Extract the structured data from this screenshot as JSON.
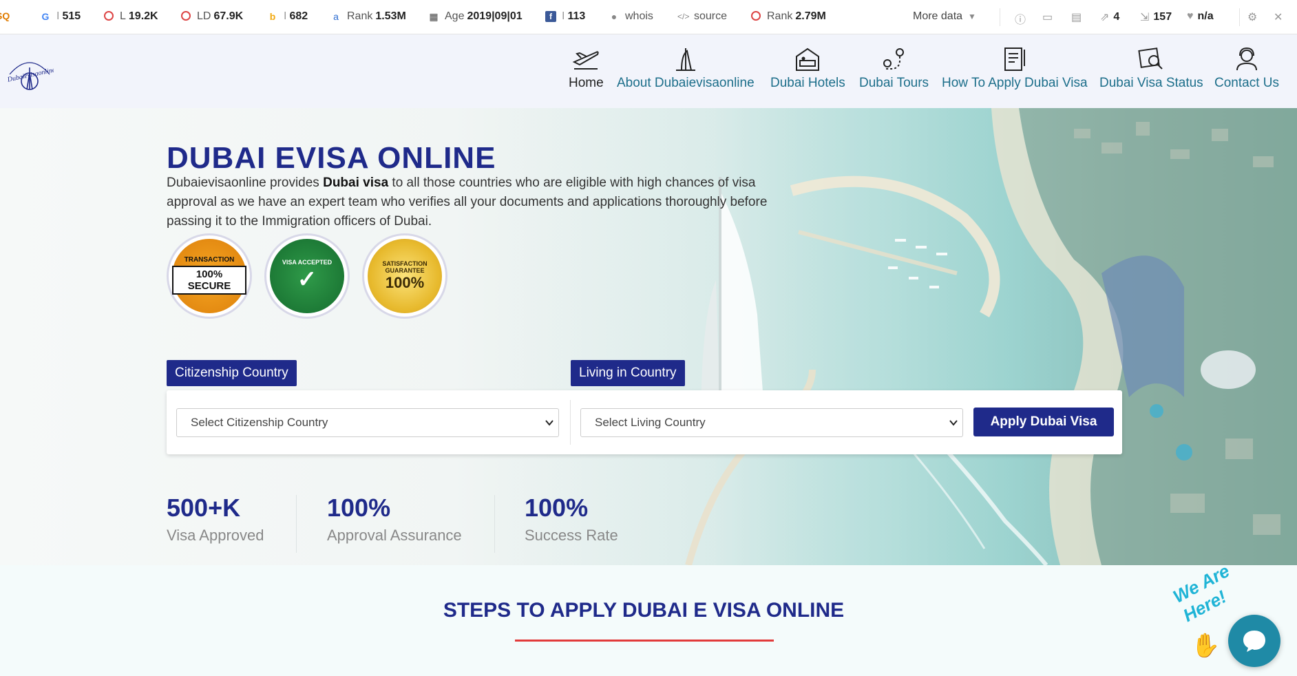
{
  "seo_bar": {
    "google": "515",
    "links": "19.2K",
    "link_domains": "67.9K",
    "bing": "682",
    "rank1": "1.53M",
    "age": "2019|09|01",
    "facebook": "113",
    "whois": "whois",
    "source": "source",
    "rank2": "2.79M",
    "more_data": "More data",
    "external_links": "4",
    "internal_links": "157",
    "na": "n/a"
  },
  "header": {
    "logo_text": "Dubaievisaonline",
    "nav": [
      {
        "label": "Home"
      },
      {
        "label": "About Dubaievisaonline"
      },
      {
        "label": "Dubai Hotels"
      },
      {
        "label": "Dubai Tours"
      },
      {
        "label": "How To Apply Dubai Visa"
      },
      {
        "label": "Dubai Visa Status"
      },
      {
        "label": "Contact Us"
      }
    ]
  },
  "hero": {
    "title": "DUBAI EVISA ONLINE",
    "desc_start": "Dubaievisaonline provides ",
    "desc_bold": "Dubai visa",
    "desc_end": " to all those countries who are eligible with high chances of visa approval as we have an expert team who verifies all your documents and applications thoroughly before passing it to the Immigration officers of Dubai.",
    "badges": [
      {
        "text": "100% SECURE",
        "ring_text": "TRANSACTION"
      },
      {
        "text": "✓",
        "ring_text": "VISA ACCEPTED"
      },
      {
        "text": "100%",
        "ring_text": "SATISFACTION GUARANTEE"
      }
    ]
  },
  "form": {
    "citizenship_label": "Citizenship Country",
    "living_label": "Living in Country",
    "citizenship_placeholder": "Select Citizenship Country",
    "living_placeholder": "Select Living Country",
    "apply_button": "Apply Dubai Visa"
  },
  "stats": [
    {
      "value": "500+K",
      "label": "Visa Approved"
    },
    {
      "value": "100%",
      "label": "Approval Assurance"
    },
    {
      "value": "100%",
      "label": "Success Rate"
    }
  ],
  "steps": {
    "title": "STEPS TO APPLY DUBAI E VISA ONLINE"
  },
  "chat": {
    "tagline": "We Are Here!"
  },
  "colors": {
    "brand_navy": "#1f2a8a",
    "nav_link": "#1c6e8a",
    "accent_red": "#e23b3b",
    "chat_teal": "#1f8aa6"
  }
}
